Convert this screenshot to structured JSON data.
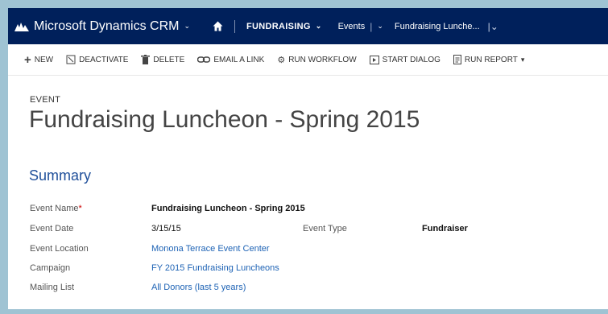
{
  "nav": {
    "brand": "Microsoft Dynamics CRM",
    "area": "FUNDRAISING",
    "entity": "Events",
    "record": "Fundraising Lunche..."
  },
  "toolbar": {
    "new": "NEW",
    "deactivate": "DEACTIVATE",
    "delete": "DELETE",
    "email_link": "EMAIL A LINK",
    "run_workflow": "RUN WORKFLOW",
    "start_dialog": "START DIALOG",
    "run_report": "RUN REPORT"
  },
  "header": {
    "entity_type": "EVENT",
    "title": "Fundraising Luncheon - Spring 2015"
  },
  "summary": {
    "title": "Summary",
    "event_name_label": "Event Name",
    "event_name": "Fundraising Luncheon - Spring 2015",
    "event_date_label": "Event Date",
    "event_date": "3/15/15",
    "event_type_label": "Event Type",
    "event_type": "Fundraiser",
    "event_location_label": "Event Location",
    "event_location": "Monona Terrace Event Center",
    "campaign_label": "Campaign",
    "campaign": "FY 2015 Fundraising Luncheons",
    "mailing_list_label": "Mailing List",
    "mailing_list": "All Donors (last 5 years)"
  },
  "colors": {
    "navbar": "#00205b",
    "link": "#1e63b5",
    "section_title": "#1f4f9a",
    "background": "#9fc3d3"
  }
}
